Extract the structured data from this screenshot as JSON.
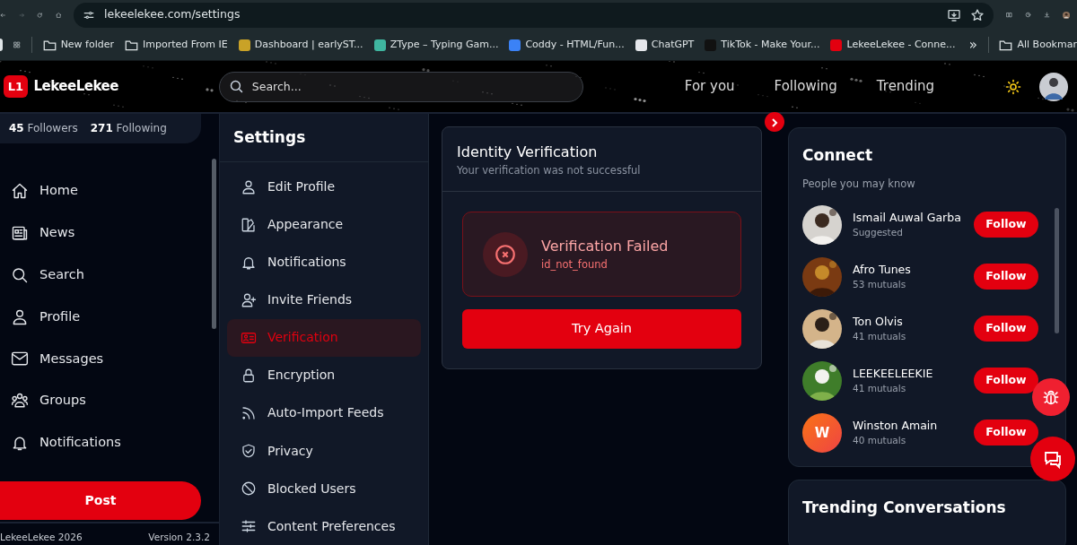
{
  "browser": {
    "url": "lekeelekee.com/settings",
    "bookmarks": [
      {
        "kind": "folder",
        "label": "New folder"
      },
      {
        "kind": "folder",
        "label": "Imported From IE"
      },
      {
        "kind": "site",
        "label": "Dashboard | earlyST...",
        "color": "#c9a227"
      },
      {
        "kind": "site",
        "label": "ZType – Typing Gam...",
        "color": "#3fb6a0"
      },
      {
        "kind": "site",
        "label": "Coddy - HTML/Fun...",
        "color": "#3b82f6"
      },
      {
        "kind": "site",
        "label": "ChatGPT",
        "color": "#e5e7eb"
      },
      {
        "kind": "site",
        "label": "TikTok - Make Your...",
        "color": "#111111"
      },
      {
        "kind": "site",
        "label": "LekeeLekee - Conne...",
        "color": "#e3000f"
      }
    ],
    "more": "»",
    "all_bookmarks": "All Bookmar"
  },
  "header": {
    "logo_mark": "L1",
    "logo": "LekeeLekee",
    "search": {
      "placeholder": "Search..."
    },
    "tabs": [
      "For you",
      "Following",
      "Trending"
    ]
  },
  "sidebar": {
    "stats": [
      {
        "count": "45",
        "label": "Followers"
      },
      {
        "count": "271",
        "label": "Following"
      }
    ],
    "items": [
      {
        "label": "Home"
      },
      {
        "label": "News"
      },
      {
        "label": "Search"
      },
      {
        "label": "Profile"
      },
      {
        "label": "Messages"
      },
      {
        "label": "Groups"
      },
      {
        "label": "Notifications"
      }
    ],
    "post": "Post",
    "footer": "LekeeLekee 2026",
    "version": "Version 2.3.2"
  },
  "settings": {
    "title": "Settings",
    "items": [
      {
        "label": "Edit Profile",
        "selected": false
      },
      {
        "label": "Appearance",
        "selected": false
      },
      {
        "label": "Notifications",
        "selected": false
      },
      {
        "label": "Invite Friends",
        "selected": false
      },
      {
        "label": "Verification",
        "selected": true
      },
      {
        "label": "Encryption",
        "selected": false
      },
      {
        "label": "Auto-Import Feeds",
        "selected": false
      },
      {
        "label": "Privacy",
        "selected": false
      },
      {
        "label": "Blocked Users",
        "selected": false
      },
      {
        "label": "Content Preferences",
        "selected": false
      }
    ]
  },
  "verification": {
    "title": "Identity Verification",
    "subtitle": "Your verification was not successful",
    "status_title": "Verification Failed",
    "status_code": "id_not_found",
    "button": "Try Again"
  },
  "connect": {
    "title": "Connect",
    "subtitle": "People you may know",
    "people": [
      {
        "name": "Ismail Auwal Garba",
        "meta": "Suggested",
        "button": "Follow"
      },
      {
        "name": "Afro Tunes",
        "meta": "53 mutuals",
        "button": "Follow"
      },
      {
        "name": "Ton Olvis",
        "meta": "41 mutuals",
        "button": "Follow"
      },
      {
        "name": "LEEKEELEEKIE",
        "meta": "41 mutuals",
        "button": "Follow"
      },
      {
        "name": "Winston Amain",
        "meta": "40 mutuals",
        "avatar": {
          "kind": "initial",
          "text": "W"
        },
        "button": "Follow"
      }
    ]
  },
  "trending": {
    "title": "Trending Conversations"
  }
}
